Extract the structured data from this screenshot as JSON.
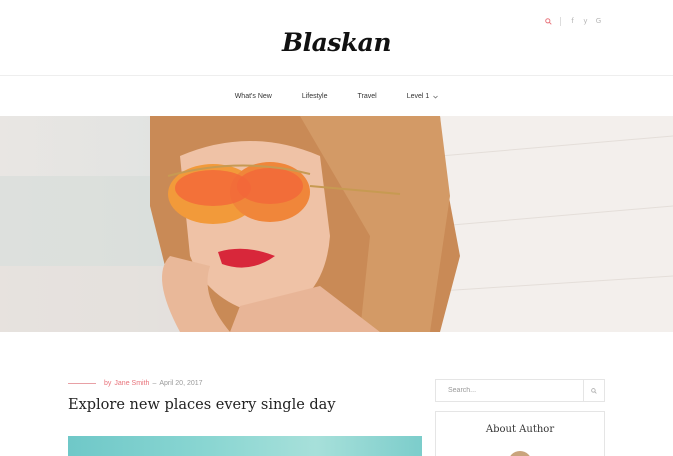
{
  "site": {
    "logo": "Blaskan"
  },
  "header": {
    "icons": [
      "search-icon",
      "facebook-icon",
      "twitter-icon",
      "google-plus-icon"
    ],
    "icon_glyphs": {
      "facebook": "f",
      "twitter": "y",
      "google_plus": "G"
    },
    "search_color": "#e8737b"
  },
  "nav": {
    "items": [
      {
        "label": "What's New"
      },
      {
        "label": "Lifestyle"
      },
      {
        "label": "Travel"
      },
      {
        "label": "Level 1"
      }
    ]
  },
  "post": {
    "by": "by",
    "author": "Jane Smith",
    "dash": "–",
    "date": "April 20, 2017",
    "title": "Explore new places every single day"
  },
  "sidebar": {
    "search_placeholder": "Search...",
    "about_title": "About Author"
  },
  "colors": {
    "accent": "#e8737b",
    "border": "#e5e5e5"
  }
}
